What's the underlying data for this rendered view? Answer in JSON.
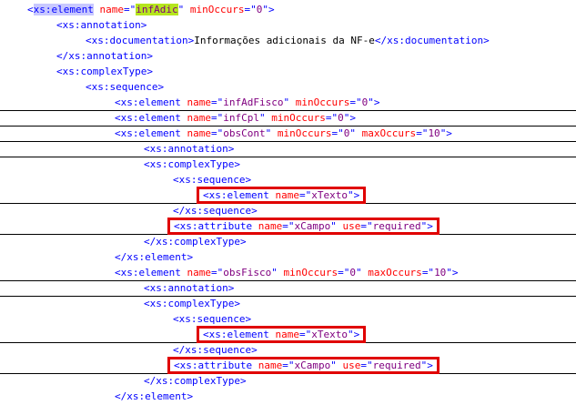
{
  "colors": {
    "tag": "#0000ff",
    "attribute": "#ff0000",
    "value": "#800080",
    "text": "#000000",
    "box": "#e00000",
    "tag_highlight": "#c8c8ff",
    "value_highlight": "#b5e61d"
  },
  "lines": [
    {
      "indent": 0,
      "parts": [
        {
          "c": "t",
          "s": "<"
        },
        {
          "c": "t hl-tag",
          "s": "xs:element"
        },
        {
          "c": "x",
          "s": " "
        },
        {
          "c": "a",
          "s": "name"
        },
        {
          "c": "t",
          "s": "=\""
        },
        {
          "c": "v hl-name",
          "s": "infAdic"
        },
        {
          "c": "t",
          "s": "\""
        },
        {
          "c": "x",
          "s": " "
        },
        {
          "c": "a",
          "s": "minOccurs"
        },
        {
          "c": "t",
          "s": "=\""
        },
        {
          "c": "v",
          "s": "0"
        },
        {
          "c": "t",
          "s": "\">"
        }
      ]
    },
    {
      "indent": 1,
      "parts": [
        {
          "c": "t",
          "s": "<xs:annotation>"
        }
      ]
    },
    {
      "indent": 2,
      "parts": [
        {
          "c": "t",
          "s": "<xs:documentation>"
        },
        {
          "c": "x",
          "s": "Informações adicionais da NF-e"
        },
        {
          "c": "t",
          "s": "</xs:documentation>"
        }
      ]
    },
    {
      "indent": 1,
      "parts": [
        {
          "c": "t",
          "s": "</xs:annotation>"
        }
      ]
    },
    {
      "indent": 1,
      "parts": [
        {
          "c": "t",
          "s": "<xs:complexType>"
        }
      ]
    },
    {
      "indent": 2,
      "parts": [
        {
          "c": "t",
          "s": "<xs:sequence>"
        }
      ]
    },
    {
      "indent": 3,
      "sep": true,
      "parts": [
        {
          "c": "t",
          "s": "<xs:element "
        },
        {
          "c": "a",
          "s": "name"
        },
        {
          "c": "t",
          "s": "=\""
        },
        {
          "c": "v",
          "s": "infAdFisco"
        },
        {
          "c": "t",
          "s": "\" "
        },
        {
          "c": "a",
          "s": "minOccurs"
        },
        {
          "c": "t",
          "s": "=\""
        },
        {
          "c": "v",
          "s": "0"
        },
        {
          "c": "t",
          "s": "\">"
        }
      ]
    },
    {
      "indent": 3,
      "sep": true,
      "parts": [
        {
          "c": "t",
          "s": "<xs:element "
        },
        {
          "c": "a",
          "s": "name"
        },
        {
          "c": "t",
          "s": "=\""
        },
        {
          "c": "v",
          "s": "infCpl"
        },
        {
          "c": "t",
          "s": "\" "
        },
        {
          "c": "a",
          "s": "minOccurs"
        },
        {
          "c": "t",
          "s": "=\""
        },
        {
          "c": "v",
          "s": "0"
        },
        {
          "c": "t",
          "s": "\">"
        }
      ]
    },
    {
      "indent": 3,
      "sep": true,
      "parts": [
        {
          "c": "t",
          "s": "<xs:element "
        },
        {
          "c": "a",
          "s": "name"
        },
        {
          "c": "t",
          "s": "=\""
        },
        {
          "c": "v",
          "s": "obsCont"
        },
        {
          "c": "t",
          "s": "\" "
        },
        {
          "c": "a",
          "s": "minOccurs"
        },
        {
          "c": "t",
          "s": "=\""
        },
        {
          "c": "v",
          "s": "0"
        },
        {
          "c": "t",
          "s": "\" "
        },
        {
          "c": "a",
          "s": "maxOccurs"
        },
        {
          "c": "t",
          "s": "=\""
        },
        {
          "c": "v",
          "s": "10"
        },
        {
          "c": "t",
          "s": "\">"
        }
      ]
    },
    {
      "indent": 4,
      "sep": true,
      "parts": [
        {
          "c": "t",
          "s": "<xs:annotation>"
        }
      ]
    },
    {
      "indent": 4,
      "parts": [
        {
          "c": "t",
          "s": "<xs:complexType>"
        }
      ]
    },
    {
      "indent": 5,
      "parts": [
        {
          "c": "t",
          "s": "<xs:sequence>"
        }
      ]
    },
    {
      "indent": 6,
      "boxed": true,
      "sep": true,
      "parts": [
        {
          "c": "t",
          "s": "<xs:element "
        },
        {
          "c": "a",
          "s": "name"
        },
        {
          "c": "t",
          "s": "=\""
        },
        {
          "c": "v",
          "s": "xTexto"
        },
        {
          "c": "t",
          "s": "\">"
        }
      ]
    },
    {
      "indent": 5,
      "parts": [
        {
          "c": "t",
          "s": "</xs:sequence>"
        }
      ]
    },
    {
      "indent": 5,
      "boxed": true,
      "sep": true,
      "parts": [
        {
          "c": "t",
          "s": "<xs:attribute "
        },
        {
          "c": "a",
          "s": "name"
        },
        {
          "c": "t",
          "s": "=\""
        },
        {
          "c": "v",
          "s": "xCampo"
        },
        {
          "c": "t",
          "s": "\" "
        },
        {
          "c": "a",
          "s": "use"
        },
        {
          "c": "t",
          "s": "=\""
        },
        {
          "c": "v",
          "s": "required"
        },
        {
          "c": "t",
          "s": "\">"
        }
      ]
    },
    {
      "indent": 4,
      "parts": [
        {
          "c": "t",
          "s": "</xs:complexType>"
        }
      ]
    },
    {
      "indent": 3,
      "parts": [
        {
          "c": "t",
          "s": "</xs:element>"
        }
      ]
    },
    {
      "indent": 3,
      "sep": true,
      "parts": [
        {
          "c": "t",
          "s": "<xs:element "
        },
        {
          "c": "a",
          "s": "name"
        },
        {
          "c": "t",
          "s": "=\""
        },
        {
          "c": "v",
          "s": "obsFisco"
        },
        {
          "c": "t",
          "s": "\" "
        },
        {
          "c": "a",
          "s": "minOccurs"
        },
        {
          "c": "t",
          "s": "=\""
        },
        {
          "c": "v",
          "s": "0"
        },
        {
          "c": "t",
          "s": "\" "
        },
        {
          "c": "a",
          "s": "maxOccurs"
        },
        {
          "c": "t",
          "s": "=\""
        },
        {
          "c": "v",
          "s": "10"
        },
        {
          "c": "t",
          "s": "\">"
        }
      ]
    },
    {
      "indent": 4,
      "sep": true,
      "parts": [
        {
          "c": "t",
          "s": "<xs:annotation>"
        }
      ]
    },
    {
      "indent": 4,
      "parts": [
        {
          "c": "t",
          "s": "<xs:complexType>"
        }
      ]
    },
    {
      "indent": 5,
      "parts": [
        {
          "c": "t",
          "s": "<xs:sequence>"
        }
      ]
    },
    {
      "indent": 6,
      "boxed": true,
      "sep": true,
      "parts": [
        {
          "c": "t",
          "s": "<xs:element "
        },
        {
          "c": "a",
          "s": "name"
        },
        {
          "c": "t",
          "s": "=\""
        },
        {
          "c": "v",
          "s": "xTexto"
        },
        {
          "c": "t",
          "s": "\">"
        }
      ]
    },
    {
      "indent": 5,
      "parts": [
        {
          "c": "t",
          "s": "</xs:sequence>"
        }
      ]
    },
    {
      "indent": 5,
      "boxed": true,
      "sep": true,
      "parts": [
        {
          "c": "t",
          "s": "<xs:attribute "
        },
        {
          "c": "a",
          "s": "name"
        },
        {
          "c": "t",
          "s": "=\""
        },
        {
          "c": "v",
          "s": "xCampo"
        },
        {
          "c": "t",
          "s": "\" "
        },
        {
          "c": "a",
          "s": "use"
        },
        {
          "c": "t",
          "s": "=\""
        },
        {
          "c": "v",
          "s": "required"
        },
        {
          "c": "t",
          "s": "\">"
        }
      ]
    },
    {
      "indent": 4,
      "parts": [
        {
          "c": "t",
          "s": "</xs:complexType>"
        }
      ]
    },
    {
      "indent": 3,
      "parts": [
        {
          "c": "t",
          "s": "</xs:element>"
        }
      ]
    }
  ]
}
